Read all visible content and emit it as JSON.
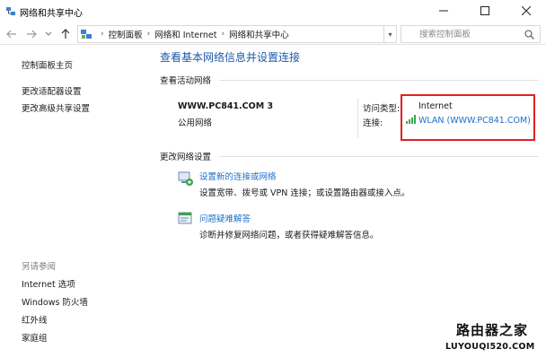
{
  "window": {
    "title": "网络和共享中心",
    "minimize_icon": "minimize-icon",
    "maximize_icon": "maximize-icon",
    "close_icon": "close-icon"
  },
  "addressbar": {
    "crumbs": [
      "控制面板",
      "网络和 Internet",
      "网络和共享中心"
    ],
    "search_placeholder": "搜索控制面板"
  },
  "sidebar": {
    "links": [
      "控制面板主页",
      "更改适配器设置",
      "更改高级共享设置"
    ],
    "see_also_label": "另请参阅",
    "see_also": [
      "Internet 选项",
      "Windows 防火墙",
      "红外线",
      "家庭组"
    ]
  },
  "main": {
    "title": "查看基本网络信息并设置连接",
    "active_networks_header": "查看活动网络",
    "network": {
      "name": "WWW.PC841.COM  3",
      "category": "公用网络",
      "access_type_label": "访问类型:",
      "access_type_value": "Internet",
      "connections_label": "连接:",
      "connection_value": "WLAN (WWW.PC841.COM)"
    },
    "change_settings_header": "更改网络设置",
    "tasks": [
      {
        "title": "设置新的连接或网络",
        "desc": "设置宽带、拨号或 VPN 连接；或设置路由器或接入点。"
      },
      {
        "title": "问题疑难解答",
        "desc": "诊断并修复网络问题，或者获得疑难解答信息。"
      }
    ]
  },
  "watermark": {
    "line1": "路由器之家",
    "line2": "LUYOUQI520.COM"
  },
  "colors": {
    "link": "#1e6fc8",
    "title": "#1e5aa8",
    "highlight_box": "#e02020",
    "signal": "#3aa64a"
  }
}
